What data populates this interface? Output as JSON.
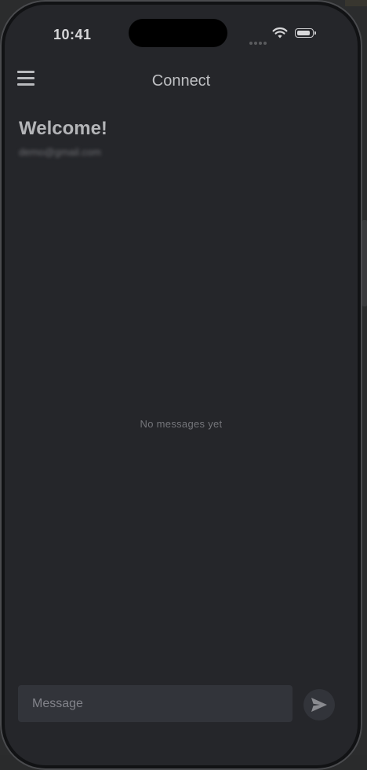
{
  "status_bar": {
    "time": "10:41",
    "battery_level": 0.9,
    "icons": [
      "signal-icon",
      "wifi-icon",
      "battery-icon"
    ]
  },
  "header": {
    "title": "Connect",
    "menu_icon": "hamburger-menu-icon"
  },
  "welcome": {
    "title": "Welcome!",
    "email": "demo@gmail.com"
  },
  "chat": {
    "empty_text": "No messages yet"
  },
  "composer": {
    "placeholder": "Message",
    "send_icon": "send-icon"
  },
  "colors": {
    "screen_background": "#25262a",
    "input_background": "#32343a",
    "text_primary": "#b4b5b8",
    "text_muted": "#74757a"
  }
}
